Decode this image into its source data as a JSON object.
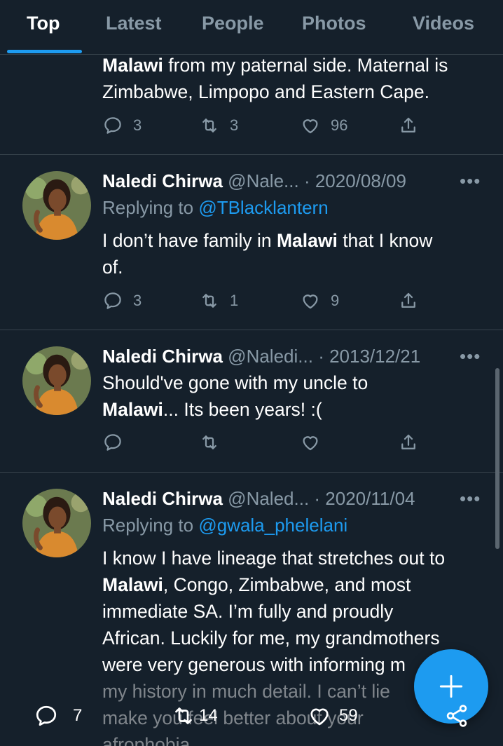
{
  "tabs": [
    "Top",
    "Latest",
    "People",
    "Photos",
    "Videos"
  ],
  "tweet0": {
    "line1_bold": "Malawi",
    "line1_rest": " from my paternal side. Maternal is",
    "line2": "Zimbabwe, Limpopo and Eastern Cape.",
    "replies": "3",
    "retweets": "3",
    "likes": "96"
  },
  "tweet1": {
    "name": "Naledi Chirwa",
    "handle": "@Nale...",
    "date": "2020/08/09",
    "reply_prefix": "Replying to ",
    "reply_to": "@TBlacklantern",
    "text_pre": "I don’t have family in ",
    "text_bold": "Malawi",
    "text_post": " that I know",
    "text_line2": "of.",
    "replies": "3",
    "retweets": "1",
    "likes": "9"
  },
  "tweet2": {
    "name": "Naledi Chirwa",
    "handle": "@Naledi...",
    "date": "2013/12/21",
    "text_line1": "Should've gone with my uncle to",
    "text_bold": "Malawi",
    "text_post": "... Its been years! :("
  },
  "tweet3": {
    "name": "Naledi Chirwa",
    "handle": "@Naled...",
    "date": "2020/11/04",
    "reply_prefix": "Replying to ",
    "reply_to": "@gwala_phelelani",
    "line1": "I know I have lineage that stretches out to",
    "line2_bold": "Malawi",
    "line2_rest": ", Congo, Zimbabwe, and most",
    "line3": "immediate SA. I’m fully and proudly",
    "line4": "African. Luckily for me, my grandmothers",
    "line5": "were very generous with informing m",
    "line6": "my history in much detail. I can’t lie",
    "line7": "make you feel better about your",
    "line8": "afrophobia"
  },
  "bottom_bar": {
    "replies": "7",
    "retweets": "14",
    "likes": "59"
  },
  "colors": {
    "background": "#15202b",
    "accent": "#1d9bf0",
    "muted": "#8899a6",
    "divider": "#38444d"
  }
}
